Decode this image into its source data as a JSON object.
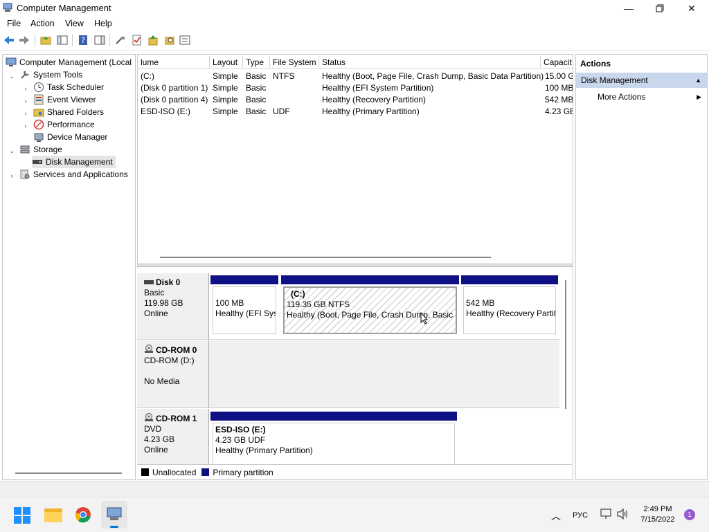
{
  "window": {
    "title": "Computer Management"
  },
  "menu": [
    "File",
    "Action",
    "View",
    "Help"
  ],
  "tree": {
    "root": "Computer Management (Local",
    "system_tools": "System Tools",
    "task_scheduler": "Task Scheduler",
    "event_viewer": "Event Viewer",
    "shared_folders": "Shared Folders",
    "performance": "Performance",
    "device_manager": "Device Manager",
    "storage": "Storage",
    "disk_management": "Disk Management",
    "services": "Services and Applications"
  },
  "volume_list": {
    "columns": [
      "lume",
      "Layout",
      "Type",
      "File System",
      "Status",
      "Capacit"
    ],
    "rows": [
      [
        "(C:)",
        "Simple",
        "Basic",
        "NTFS",
        "Healthy (Boot, Page File, Crash Dump, Basic Data Partition)",
        "15.00 G"
      ],
      [
        "(Disk 0 partition 1)",
        "Simple",
        "Basic",
        "",
        "Healthy (EFI System Partition)",
        "100 MB"
      ],
      [
        "(Disk 0 partition 4)",
        "Simple",
        "Basic",
        "",
        "Healthy (Recovery Partition)",
        "542 MB"
      ],
      [
        "ESD-ISO (E:)",
        "Simple",
        "Basic",
        "UDF",
        "Healthy (Primary Partition)",
        "4.23 GB"
      ]
    ]
  },
  "disks": {
    "disk0": {
      "name": "Disk 0",
      "type": "Basic",
      "size": "119.98 GB",
      "state": "Online",
      "parts": [
        {
          "title": "",
          "size": "100 MB",
          "status": "Healthy (EFI Syst"
        },
        {
          "title": "(C:)",
          "size": "119.35 GB NTFS",
          "status": "Healthy (Boot, Page File, Crash Dump, Basic Da"
        },
        {
          "title": "",
          "size": "542 MB",
          "status": "Healthy (Recovery Partit"
        }
      ]
    },
    "cdrom0": {
      "name": "CD-ROM 0",
      "type": "CD-ROM (D:)",
      "state": "No Media"
    },
    "cdrom1": {
      "name": "CD-ROM 1",
      "type": "DVD",
      "size": "4.23 GB",
      "state": "Online",
      "part": {
        "title": "ESD-ISO  (E:)",
        "size": "4.23 GB UDF",
        "status": "Healthy (Primary Partition)"
      }
    }
  },
  "legend": {
    "unallocated": "Unallocated",
    "primary": "Primary partition",
    "unallocated_color": "#000000",
    "primary_color": "#0f0f86"
  },
  "actions": {
    "header": "Actions",
    "section": "Disk Management",
    "more": "More Actions"
  },
  "taskbar": {
    "language": "РУС",
    "time": "2:49 PM",
    "date": "7/15/2022",
    "notification_count": "1"
  },
  "colors": {
    "partition_header": "#0f0f86",
    "selected_section": "#c9d7ec",
    "accent": "#0078d4"
  }
}
